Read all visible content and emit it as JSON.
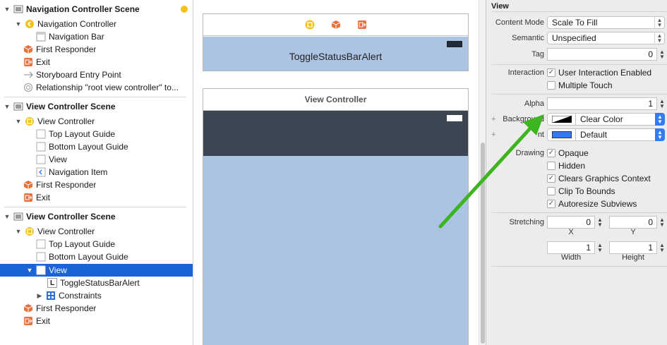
{
  "outline": {
    "scene1": {
      "title": "Navigation Controller Scene",
      "items": [
        {
          "label": "Navigation Controller"
        },
        {
          "label": "Navigation Bar"
        },
        {
          "label": "First Responder"
        },
        {
          "label": "Exit"
        },
        {
          "label": "Storyboard Entry Point"
        },
        {
          "label": "Relationship \"root view controller\" to..."
        }
      ]
    },
    "scene2": {
      "title": "View Controller Scene",
      "items": [
        {
          "label": "View Controller"
        },
        {
          "label": "Top Layout Guide"
        },
        {
          "label": "Bottom Layout Guide"
        },
        {
          "label": "View"
        },
        {
          "label": "Navigation Item"
        },
        {
          "label": "First Responder"
        },
        {
          "label": "Exit"
        }
      ]
    },
    "scene3": {
      "title": "View Controller Scene",
      "items": [
        {
          "label": "View Controller"
        },
        {
          "label": "Top Layout Guide"
        },
        {
          "label": "Bottom Layout Guide"
        },
        {
          "label": "View"
        },
        {
          "label": "ToggleStatusBarAlert"
        },
        {
          "label": "Constraints"
        },
        {
          "label": "First Responder"
        },
        {
          "label": "Exit"
        }
      ]
    },
    "label_glyph": "L"
  },
  "canvas": {
    "top_vc_title": "ToggleStatusBarAlert",
    "bottom_vc_title": "View Controller"
  },
  "inspector": {
    "section_title": "View",
    "content_mode": {
      "label": "Content Mode",
      "value": "Scale To Fill"
    },
    "semantic": {
      "label": "Semantic",
      "value": "Unspecified"
    },
    "tag": {
      "label": "Tag",
      "value": "0"
    },
    "interaction": {
      "label": "Interaction",
      "user_interaction": {
        "label": "User Interaction Enabled",
        "checked": true
      },
      "multiple_touch": {
        "label": "Multiple Touch",
        "checked": false
      }
    },
    "alpha": {
      "label": "Alpha",
      "value": "1"
    },
    "background": {
      "label": "Background",
      "value": "Clear Color"
    },
    "tint": {
      "label": "nt",
      "value": "Default",
      "swatch": "#2f7cf6"
    },
    "drawing": {
      "label": "Drawing",
      "opaque": {
        "label": "Opaque",
        "checked": true
      },
      "hidden": {
        "label": "Hidden",
        "checked": false
      },
      "clears_graphics": {
        "label": "Clears Graphics Context",
        "checked": true
      },
      "clip_to_bounds": {
        "label": "Clip To Bounds",
        "checked": false
      },
      "autoresize": {
        "label": "Autoresize Subviews",
        "checked": true
      }
    },
    "stretching": {
      "label": "Stretching",
      "x": {
        "value": "0",
        "caption": "X"
      },
      "y": {
        "value": "0",
        "caption": "Y"
      },
      "width": {
        "value": "1",
        "caption": "Width"
      },
      "height": {
        "value": "1",
        "caption": "Height"
      }
    }
  },
  "colors": {
    "selection": "#1a63d8",
    "nav_bar_dark": "#3c4653",
    "view_bg": "#acc4e3",
    "arrow": "#3cb521",
    "storyboard_orange": "#e8703a",
    "vc_yellow": "#f3c21b"
  }
}
